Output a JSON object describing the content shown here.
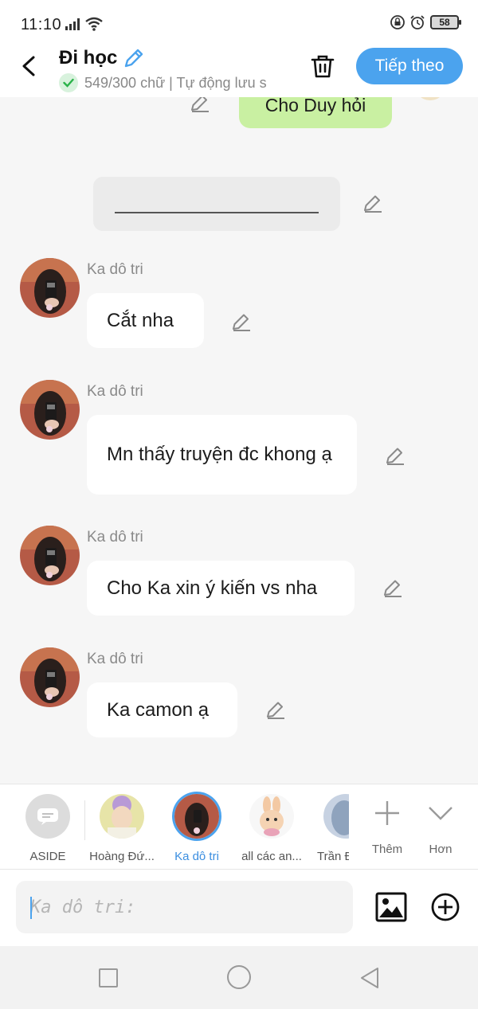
{
  "status": {
    "time": "11:10",
    "battery": "58"
  },
  "header": {
    "title": "Đi học",
    "subtitle": "549/300 chữ | Tự động lưu s",
    "next_label": "Tiếp theo"
  },
  "chat": {
    "top_message": "Cho Duy hỏi",
    "messages": [
      {
        "sender": "Ka dô tri",
        "text": "Cắt nha"
      },
      {
        "sender": "Ka dô tri",
        "text": "Mn thấy truyện đc khong ạ"
      },
      {
        "sender": "Ka dô tri",
        "text": "Cho Ka xin ý kiến vs nha"
      },
      {
        "sender": "Ka dô tri",
        "text": "Ka camon ạ"
      }
    ]
  },
  "characters": [
    {
      "name": "ASIDE"
    },
    {
      "name": "Hoàng Đứ..."
    },
    {
      "name": "Ka dô tri"
    },
    {
      "name": "all các an..."
    },
    {
      "name": "Trần Đ"
    }
  ],
  "tools": {
    "add_label": "Thêm",
    "more_label": "Hơn"
  },
  "input": {
    "placeholder": "Ka dô tri:"
  },
  "colors": {
    "accent": "#4ba3ee",
    "right_bubble": "#c9f0a2"
  }
}
